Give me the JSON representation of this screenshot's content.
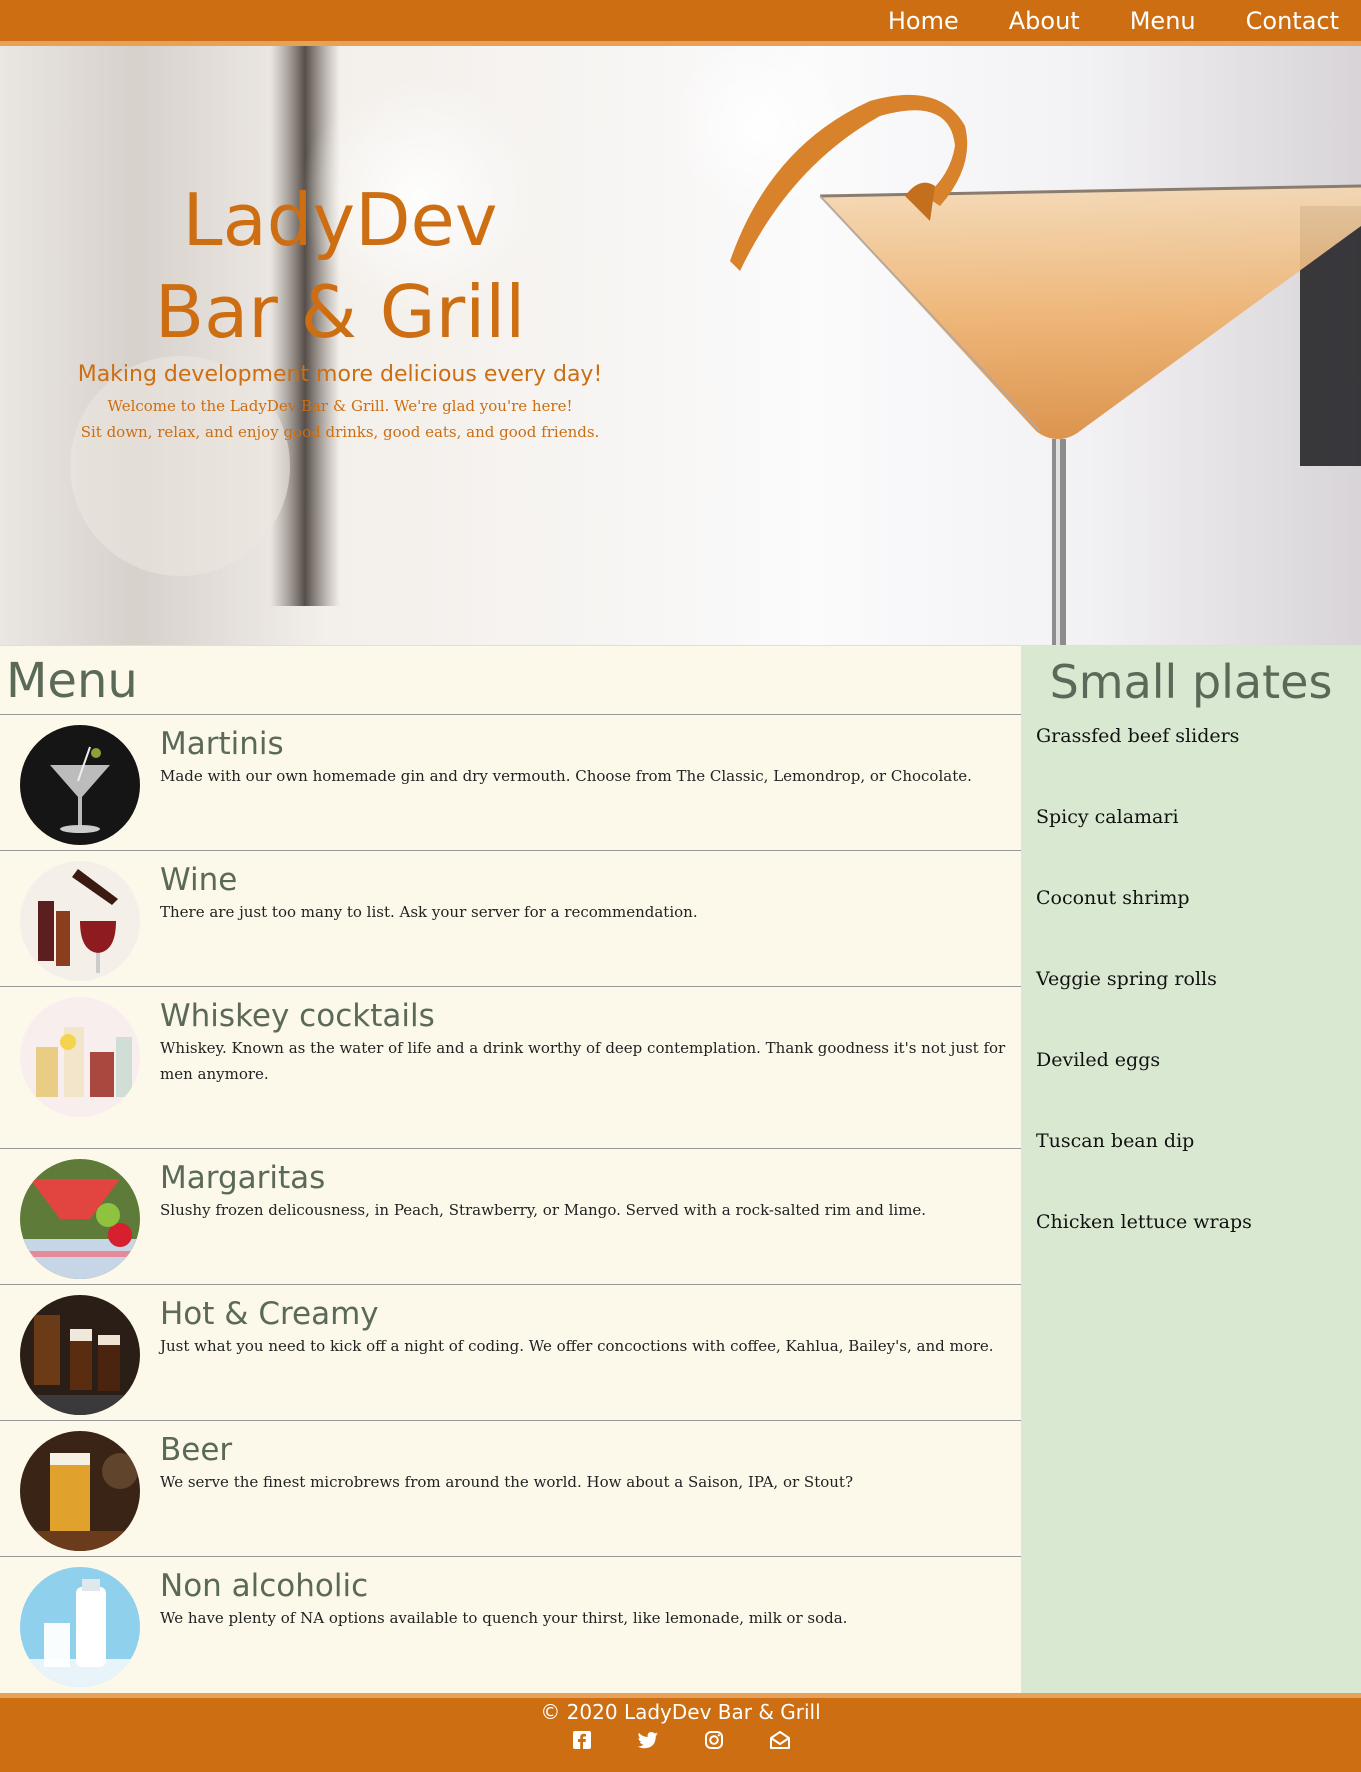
{
  "nav": {
    "items": [
      {
        "label": "Home"
      },
      {
        "label": "About"
      },
      {
        "label": "Menu"
      },
      {
        "label": "Contact"
      }
    ]
  },
  "hero": {
    "title_line1": "LadyDev",
    "title_line2": "Bar & Grill",
    "tagline": "Making development more delicious every day!",
    "welcome_line1": "Welcome to the LadyDev Bar & Grill. We're glad you're here!",
    "welcome_line2": "Sit down, relax, and enjoy good drinks, good eats, and good friends."
  },
  "menu": {
    "heading": "Menu",
    "items": [
      {
        "name": "Martinis",
        "desc": "Made with our own homemade gin and dry vermouth. Choose from The Classic, Lemondrop, or Chocolate."
      },
      {
        "name": "Wine",
        "desc": "There are just too many to list. Ask your server for a recommendation."
      },
      {
        "name": "Whiskey cocktails",
        "desc": "Whiskey. Known as the water of life and a drink worthy of deep contemplation. Thank goodness it's not just for men anymore."
      },
      {
        "name": "Margaritas",
        "desc": "Slushy frozen delicousness, in Peach, Strawberry, or Mango. Served with a rock-salted rim and lime."
      },
      {
        "name": "Hot & Creamy",
        "desc": "Just what you need to kick off a night of coding. We offer concoctions with coffee, Kahlua, Bailey's, and more."
      },
      {
        "name": "Beer",
        "desc": "We serve the finest microbrews from around the world. How about a Saison, IPA, or Stout?"
      },
      {
        "name": "Non alcoholic",
        "desc": "We have plenty of NA options available to quench your thirst, like lemonade, milk or soda."
      }
    ]
  },
  "small_plates": {
    "heading": "Small plates",
    "items": [
      "Grassfed beef sliders",
      "Spicy calamari",
      "Coconut shrimp",
      "Veggie spring rolls",
      "Deviled eggs",
      "Tuscan bean dip",
      "Chicken lettuce wraps"
    ]
  },
  "footer": {
    "copyright": "© 2020 LadyDev Bar & Grill",
    "social_icons": [
      "facebook-icon",
      "twitter-icon",
      "instagram-icon",
      "envelope-icon"
    ]
  },
  "colors": {
    "brand_orange": "#cc6e11",
    "accent_orange": "#e8a158",
    "menu_bg": "#fcf9eb",
    "plates_bg": "#d9e9d1",
    "heading_green": "#5b6a58"
  }
}
